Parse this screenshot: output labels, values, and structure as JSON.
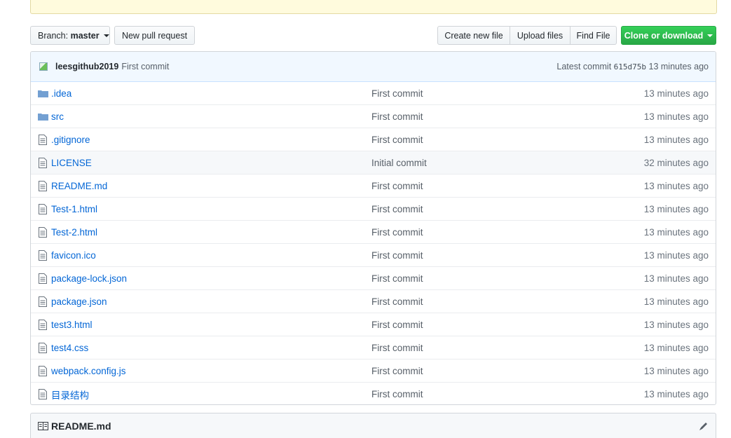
{
  "toolbar": {
    "branch_prefix": "Branch:",
    "branch_name": "master",
    "new_pull_request": "New pull request",
    "create_new_file": "Create new file",
    "upload_files": "Upload files",
    "find_file": "Find File",
    "clone_or_download": "Clone or download"
  },
  "commit": {
    "author": "leesgithub2019",
    "message": "First commit",
    "latest_label": "Latest commit",
    "sha": "615d75b",
    "age": "13 minutes ago"
  },
  "files": [
    {
      "name": ".idea",
      "type": "dir",
      "message": "First commit",
      "age": "13 minutes ago"
    },
    {
      "name": "src",
      "type": "dir",
      "message": "First commit",
      "age": "13 minutes ago"
    },
    {
      "name": ".gitignore",
      "type": "file",
      "message": "First commit",
      "age": "13 minutes ago"
    },
    {
      "name": "LICENSE",
      "type": "file",
      "message": "Initial commit",
      "age": "32 minutes ago"
    },
    {
      "name": "README.md",
      "type": "file",
      "message": "First commit",
      "age": "13 minutes ago"
    },
    {
      "name": "Test-1.html",
      "type": "file",
      "message": "First commit",
      "age": "13 minutes ago"
    },
    {
      "name": "Test-2.html",
      "type": "file",
      "message": "First commit",
      "age": "13 minutes ago"
    },
    {
      "name": "favicon.ico",
      "type": "file",
      "message": "First commit",
      "age": "13 minutes ago"
    },
    {
      "name": "package-lock.json",
      "type": "file",
      "message": "First commit",
      "age": "13 minutes ago"
    },
    {
      "name": "package.json",
      "type": "file",
      "message": "First commit",
      "age": "13 minutes ago"
    },
    {
      "name": "test3.html",
      "type": "file",
      "message": "First commit",
      "age": "13 minutes ago"
    },
    {
      "name": "test4.css",
      "type": "file",
      "message": "First commit",
      "age": "13 minutes ago"
    },
    {
      "name": "webpack.config.js",
      "type": "file",
      "message": "First commit",
      "age": "13 minutes ago"
    },
    {
      "name": "目录结构",
      "type": "file",
      "message": "First commit",
      "age": "13 minutes ago"
    }
  ],
  "readme": {
    "title": "README.md"
  },
  "colors": {
    "link": "#0366d6",
    "clone_button": "#28a745",
    "commit_bar": "#f1f8ff"
  }
}
